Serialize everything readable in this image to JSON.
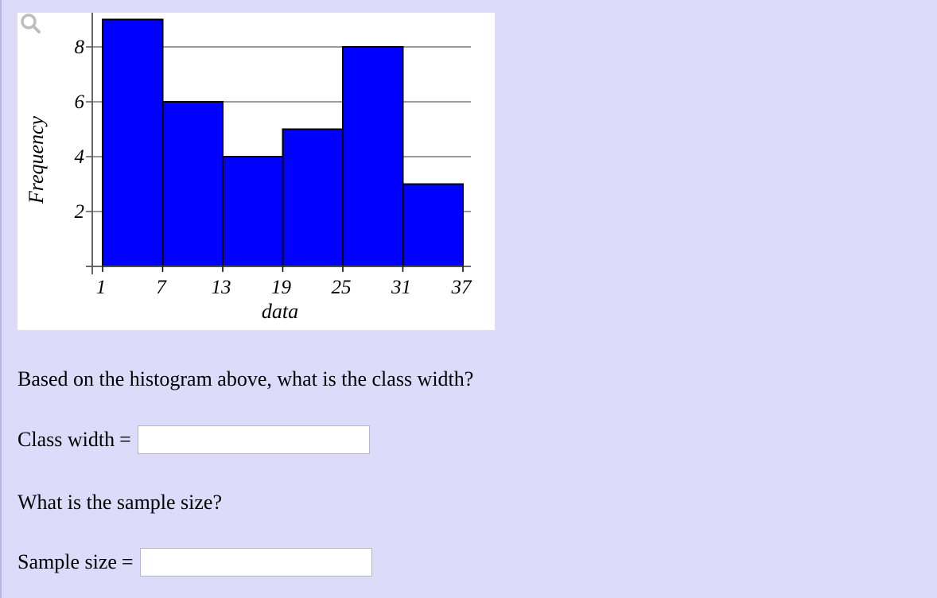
{
  "chart_data": {
    "type": "bar",
    "subtype": "histogram",
    "bin_edges": [
      1,
      7,
      13,
      19,
      25,
      31,
      37
    ],
    "categories": [
      "1-7",
      "7-13",
      "13-19",
      "19-25",
      "25-31",
      "31-37"
    ],
    "values": [
      9,
      6,
      4,
      5,
      8,
      3
    ],
    "title": "",
    "xlabel": "data",
    "ylabel": "Frequency",
    "x_ticks": [
      "1",
      "7",
      "13",
      "19",
      "25",
      "31",
      "37"
    ],
    "y_ticks": [
      "2",
      "4",
      "6",
      "8"
    ],
    "y_tick_values": [
      2,
      4,
      6,
      8
    ],
    "xlim": [
      1,
      37
    ],
    "ylim": [
      0,
      9
    ],
    "grid": "horizontal",
    "bar_color": "#0000ff",
    "bar_edge_color": "#000000"
  },
  "zoom_icon": "magnifier-icon",
  "questions": [
    {
      "prompt": "Based on the histogram above, what is the class width?",
      "label": "Class width",
      "equals": "=",
      "value": "",
      "placeholder": ""
    },
    {
      "prompt": "What is the sample size?",
      "label": "Sample size",
      "equals": "=",
      "value": "",
      "placeholder": ""
    }
  ]
}
